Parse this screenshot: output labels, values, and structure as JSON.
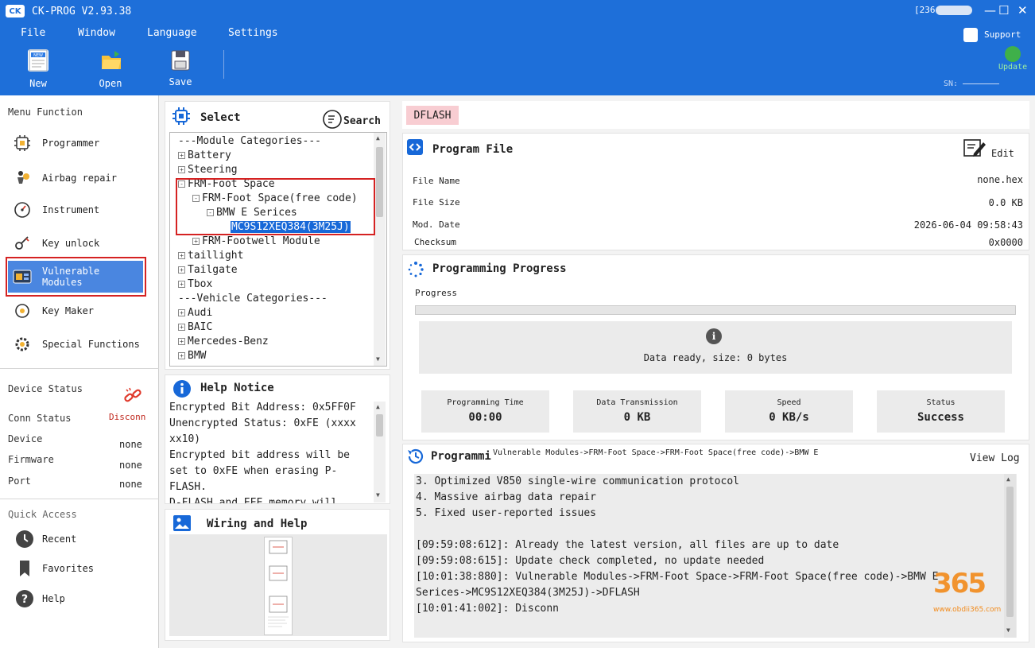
{
  "window": {
    "title": "CK-PROG V2.93.38",
    "logo_text": "CK",
    "user_id": "[236",
    "minimize": "—",
    "maximize": "☐",
    "close": "✕"
  },
  "menu": {
    "items": [
      "File",
      "Window",
      "Language",
      "Settings"
    ]
  },
  "toolbar": {
    "new_label": "New",
    "open_label": "Open",
    "save_label": "Save",
    "support_label": "Support",
    "update_label": "Update",
    "sn_label": "SN:"
  },
  "sidebar": {
    "menu_heading": "Menu Function",
    "items": [
      "Programmer",
      "Airbag repair",
      "Instrument",
      "Key unlock",
      "Vulnerable Modules",
      "Key Maker",
      "Special Functions"
    ],
    "selected": "Vulnerable Modules",
    "device_status": {
      "heading": "Device Status",
      "conn_label": "Conn Status",
      "conn_value": "Disconn",
      "device_label": "Device",
      "device_value": "none",
      "firmware_label": "Firmware",
      "firmware_value": "none",
      "port_label": "Port",
      "port_value": "none"
    },
    "quick_access": {
      "heading": "Quick Access",
      "items": [
        "Recent",
        "Favorites",
        "Help"
      ]
    }
  },
  "select_panel": {
    "title": "Select",
    "search_label": "Search",
    "tree": [
      {
        "text": "---Module  Categories---",
        "level": 0,
        "toggle": ""
      },
      {
        "text": "Battery",
        "level": 0,
        "toggle": "+"
      },
      {
        "text": "Steering",
        "level": 0,
        "toggle": "+"
      },
      {
        "text": "FRM-Foot Space",
        "level": 0,
        "toggle": "-"
      },
      {
        "text": "FRM-Foot Space(free code)",
        "level": 1,
        "toggle": "-"
      },
      {
        "text": "BMW E Serices",
        "level": 2,
        "toggle": "-"
      },
      {
        "text": "MC9S12XEQ384(3M25J)",
        "level": 3,
        "toggle": "",
        "selected": true
      },
      {
        "text": "FRM-Footwell Module",
        "level": 1,
        "toggle": "+"
      },
      {
        "text": "taillight",
        "level": 0,
        "toggle": "+"
      },
      {
        "text": "Tailgate",
        "level": 0,
        "toggle": "+"
      },
      {
        "text": "Tbox",
        "level": 0,
        "toggle": "+"
      },
      {
        "text": "---Vehicle Categories---",
        "level": 0,
        "toggle": ""
      },
      {
        "text": "Audi",
        "level": 0,
        "toggle": "+"
      },
      {
        "text": "BAIC",
        "level": 0,
        "toggle": "+"
      },
      {
        "text": "Mercedes-Benz",
        "level": 0,
        "toggle": "+"
      },
      {
        "text": "BMW",
        "level": 0,
        "toggle": "+"
      }
    ]
  },
  "help_notice": {
    "title": "Help Notice",
    "lines": [
      "Encrypted Bit Address: 0x5FF0F",
      "Unencrypted Status: 0xFE (xxxx",
      "xx10)",
      "Encrypted bit address will be",
      "set to 0xFE when erasing P-",
      "FLASH.",
      "D-FLASH and EEE memory will"
    ]
  },
  "wiring": {
    "title": "Wiring and Help"
  },
  "dflash_tag": "DFLASH",
  "program_file": {
    "title": "Program File",
    "edit_label": "Edit",
    "rows": [
      {
        "label": "File Name",
        "value": "none.hex"
      },
      {
        "label": "File Size",
        "value": "0.0 KB"
      },
      {
        "label": "Mod. Date",
        "value": "2026-06-04 09:58:43"
      },
      {
        "label": "Checksum",
        "value": "0x0000"
      }
    ]
  },
  "progress": {
    "title": "Programming Progress",
    "label": "Progress",
    "fraction": 0,
    "ready_text": "Data ready, size: 0 bytes",
    "stats": [
      {
        "label": "Programming Time",
        "value": "00:00"
      },
      {
        "label": "Data Transmission",
        "value": "0 KB"
      },
      {
        "label": "Speed",
        "value": "0 KB/s"
      },
      {
        "label": "Status",
        "value": "Success"
      }
    ]
  },
  "log": {
    "title": "Programmi",
    "path": "Vulnerable Modules->FRM-Foot Space->FRM-Foot Space(free code)->BMW E",
    "view_log_label": "View Log",
    "lines": [
      "3. Optimized V850 single-wire communication protocol",
      "4. Massive airbag data repair",
      "5. Fixed user-reported issues",
      "",
      "[09:59:08:612]: Already the latest version, all files are up to date",
      "[09:59:08:615]: Update check completed, no update needed",
      "[10:01:38:880]: Vulnerable Modules->FRM-Foot Space->FRM-Foot Space(free code)->BMW E",
      "Serices->MC9S12XEQ384(3M25J)->DFLASH",
      "[10:01:41:002]: Disconn"
    ]
  },
  "watermark": {
    "number": "365",
    "url": "www.obdii365.com"
  },
  "colors": {
    "titlebar": "#1e6fd9",
    "selected": "#4a86e0",
    "highlight_box": "#d52222",
    "disconn": "#c0281e"
  }
}
